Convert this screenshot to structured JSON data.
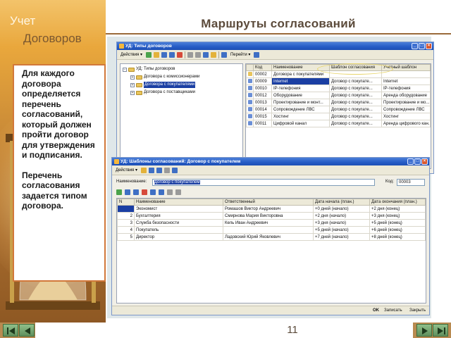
{
  "brand": {
    "line1": "Учет",
    "line2": "Договоров"
  },
  "slide": {
    "title": "Маршруты согласований",
    "page_number": "11"
  },
  "callout": {
    "paragraph1": "Для каждого договора определяется перечень согласований, который должен пройти договор для утверждения и подписания.",
    "paragraph2": "Перечень согласования задается типом договора."
  },
  "window1": {
    "title": "УД: Типы договоров",
    "toolbar": {
      "actions_label": "Действия ▾",
      "goto_label": "Перейти ▾"
    },
    "tree": [
      {
        "label": "УД: Типы договоров",
        "level": 0
      },
      {
        "label": "Договора с комиссионерами",
        "level": 1
      },
      {
        "label": "Договора с покупателями",
        "level": 1,
        "selected": true
      },
      {
        "label": "Договора с поставщиками",
        "level": 1
      }
    ],
    "grid": {
      "columns": [
        "Код",
        "Наименование",
        "Шаблон согласования",
        "Учетный шаблон"
      ],
      "rows": [
        {
          "code": "00002",
          "name": "Договора с покупателями",
          "template": "",
          "account_template": ""
        },
        {
          "code": "00009",
          "name": "Internet",
          "template": "Договор с покупате...",
          "account_template": "Internet"
        },
        {
          "code": "00010",
          "name": "IP-телефония",
          "template": "Договор с покупате...",
          "account_template": "IP-телефония"
        },
        {
          "code": "00012",
          "name": "Оборудование",
          "template": "Договор с покупате...",
          "account_template": "Аренда оборудование"
        },
        {
          "code": "00013",
          "name": "Проектирование и монт...",
          "template": "Договор с покупате...",
          "account_template": "Проектирование и мо..."
        },
        {
          "code": "00014",
          "name": "Сопровождение ЛВС",
          "template": "Договор с покупате...",
          "account_template": "Сопровождение ЛВС"
        },
        {
          "code": "00015",
          "name": "Хостинг",
          "template": "Договор с покупате...",
          "account_template": "Хостинг"
        },
        {
          "code": "00011",
          "name": "Цифровой канал",
          "template": "Договор с покупате...",
          "account_template": "Аренда цифрового кан..."
        }
      ]
    }
  },
  "window2": {
    "title": "УД: Шаблоны согласований: Договор с покупателем",
    "toolbar": {
      "actions_label": "Действия ▾"
    },
    "form": {
      "name_label": "Наименование:",
      "name_value": "Договор с покупателем",
      "code_label": "Код:",
      "code_value": "00003"
    },
    "grid": {
      "columns": [
        "N",
        "Наименование",
        "Ответственный",
        "Дата начала (план.)",
        "Дата окончания (план.)"
      ],
      "rows": [
        {
          "n": "1",
          "name": "Экономист",
          "responsible": "Ромашов Виктор Андреевич",
          "start": "+0 дней (начало)",
          "end": "+2 дня (конец)"
        },
        {
          "n": "2",
          "name": "Бухгалтерия",
          "responsible": "Смирнова Мария Викторовна",
          "start": "+2 дня (начало)",
          "end": "+3 дня (конец)"
        },
        {
          "n": "3",
          "name": "Служба безопасности",
          "responsible": "Кель Иван Андреевич",
          "start": "+3 дня (начало)",
          "end": "+5 дней (конец)"
        },
        {
          "n": "4",
          "name": "Покупатель",
          "responsible": "",
          "start": "+5 дней (начало)",
          "end": "+6 дней (конец)"
        },
        {
          "n": "5",
          "name": "Директор",
          "responsible": "Ладовский Юрий Яковлевич",
          "start": "+7 дней (начало)",
          "end": "+8 дней (конец)"
        }
      ]
    },
    "buttons": {
      "ok": "OK",
      "save": "Записать",
      "close": "Закрыть"
    }
  },
  "colors": {
    "accent": "#d2783a",
    "title_bar": "#255bc5",
    "selection": "#1b3fa3",
    "nav_button": "#5f8f5c"
  },
  "icons": [
    "hourglass-icon",
    "folder-icon",
    "nav-first-icon",
    "nav-prev-icon",
    "nav-next-icon",
    "nav-last-icon"
  ]
}
